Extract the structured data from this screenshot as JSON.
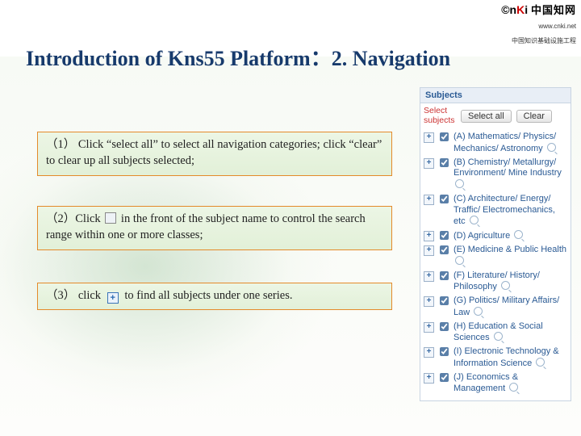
{
  "logo": {
    "brand_prefix": "©n",
    "brand_red": "K",
    "brand_suffix": "i",
    "brand_zh": "中国知网",
    "site": "www.cnki.net",
    "tagline": "中国知识基础设施工程"
  },
  "title": "Introduction of Kns55 Platform：2. Navigation",
  "notes": {
    "n1": "（1） Click  “select all” to select all navigation categories; click  “clear” to clear up all subjects selected;",
    "n2a": "（2）Click",
    "n2b": " in the front of the subject name to control the search range within one or more classes;",
    "n3a": "（3） click ",
    "n3b": " to find all subjects under one series."
  },
  "panel": {
    "header": "Subjects",
    "select_label": "Select subjects",
    "btn_select_all": "Select all",
    "btn_clear": "Clear",
    "nodes": [
      "(A) Mathematics/ Physics/ Mechanics/ Astronomy",
      "(B) Chemistry/ Metallurgy/ Environment/ Mine Industry",
      "(C) Architecture/ Energy/ Traffic/ Electromechanics, etc",
      "(D) Agriculture",
      "(E) Medicine & Public Health",
      "(F) Literature/ History/ Philosophy",
      "(G) Politics/ Military Affairs/ Law",
      "(H) Education & Social Sciences",
      "(I) Electronic Technology & Information Science",
      "(J) Economics & Management"
    ]
  }
}
